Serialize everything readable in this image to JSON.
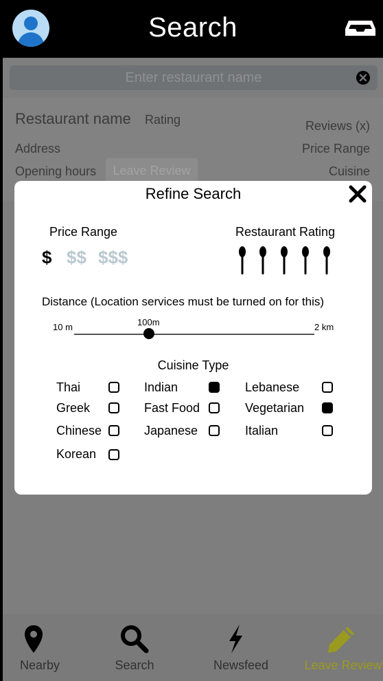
{
  "header": {
    "title": "Search",
    "left_icon": "avatar-icon",
    "right_icon": "inbox-icon"
  },
  "search": {
    "placeholder": "Enter restaurant name",
    "clear_icon": "clear-icon"
  },
  "restaurant_card": {
    "name": "Restaurant name",
    "rating": "Rating",
    "reviews": "Reviews (x)",
    "address": "Address",
    "price_range": "Price Range",
    "opening_hours": "Opening hours",
    "leave_review": "Leave Review",
    "cuisine": "Cuisine"
  },
  "refine": {
    "title": "Refine Search",
    "close_icon": "close-icon",
    "price_label": "Price Range",
    "price_options": [
      "$",
      "$$",
      "$$$"
    ],
    "price_selected": "$",
    "rating_label": "Restaurant Rating",
    "rating_icon": "spoon-icon",
    "rating_count": 5,
    "distance_label": "Distance (Location services must be turned on for this)",
    "distance_min": "10 m",
    "distance_value": "100m",
    "distance_max": "2 km",
    "cuisine_label": "Cuisine Type",
    "cuisines": [
      {
        "name": "Thai",
        "checked": false
      },
      {
        "name": "Indian",
        "checked": true
      },
      {
        "name": "Lebanese",
        "checked": false
      },
      {
        "name": "Greek",
        "checked": false
      },
      {
        "name": "Fast Food",
        "checked": false
      },
      {
        "name": "Vegetarian",
        "checked": true
      },
      {
        "name": "Chinese",
        "checked": false
      },
      {
        "name": "Japanese",
        "checked": false
      },
      {
        "name": "Italian",
        "checked": false
      },
      {
        "name": "Korean",
        "checked": false
      }
    ]
  },
  "nav": [
    {
      "label": "Nearby",
      "icon": "location-pin-icon"
    },
    {
      "label": "Search",
      "icon": "search-icon"
    },
    {
      "label": "Newsfeed",
      "icon": "lightning-icon"
    },
    {
      "label": "Leave Review",
      "icon": "pencil-icon"
    }
  ],
  "colors": {
    "header_bg": "#000000",
    "overlay": "#7e7e7e",
    "modal_bg": "#ffffff",
    "price_inactive": "#b9c8cf",
    "leave_review_accent": "#9a9a20"
  }
}
